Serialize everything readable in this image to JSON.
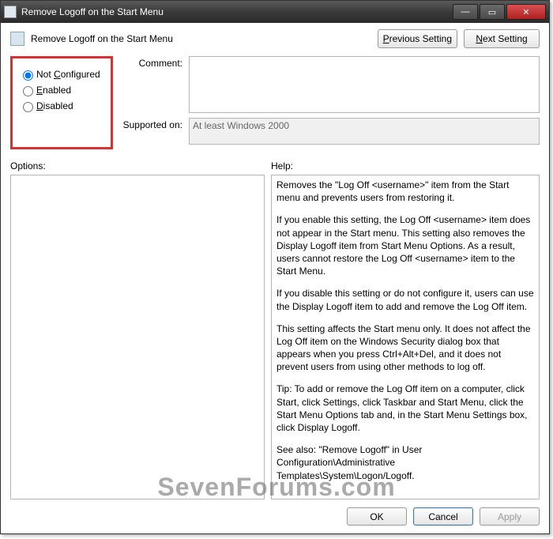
{
  "window": {
    "title": "Remove Logoff on the Start Menu"
  },
  "header": {
    "setting_title": "Remove Logoff on the Start Menu",
    "prev_btn": "Previous Setting",
    "next_btn": "Next Setting"
  },
  "radios": {
    "not_configured": "Not Configured",
    "enabled": "Enabled",
    "disabled": "Disabled",
    "selected": "not_configured"
  },
  "fields": {
    "comment_label": "Comment:",
    "comment_value": "",
    "supported_label": "Supported on:",
    "supported_value": "At least Windows 2000"
  },
  "section_labels": {
    "options": "Options:",
    "help": "Help:"
  },
  "help_text": {
    "p1": "Removes the \"Log Off <username>\" item from the Start menu and prevents users from restoring it.",
    "p2": "If you enable this setting, the Log Off <username> item does not appear in the Start menu. This setting also removes the Display Logoff item from Start Menu Options. As a result, users cannot restore the Log Off <username> item to the Start Menu.",
    "p3": "If you disable this setting or do not configure it, users can use the Display Logoff item to add and remove the Log Off item.",
    "p4": "This setting affects the Start menu only. It does not affect the Log Off item on the Windows Security dialog box that appears when you press Ctrl+Alt+Del, and it does not prevent users from using other methods to log off.",
    "p5": "Tip: To add or remove the Log Off item on a computer, click Start, click Settings, click Taskbar and Start Menu, click the Start Menu Options tab and, in the Start Menu Settings box, click Display Logoff.",
    "p6": "See also: \"Remove Logoff\" in User Configuration\\Administrative Templates\\System\\Logon/Logoff."
  },
  "footer": {
    "ok": "OK",
    "cancel": "Cancel",
    "apply": "Apply"
  },
  "watermark": "SevenForums.com"
}
